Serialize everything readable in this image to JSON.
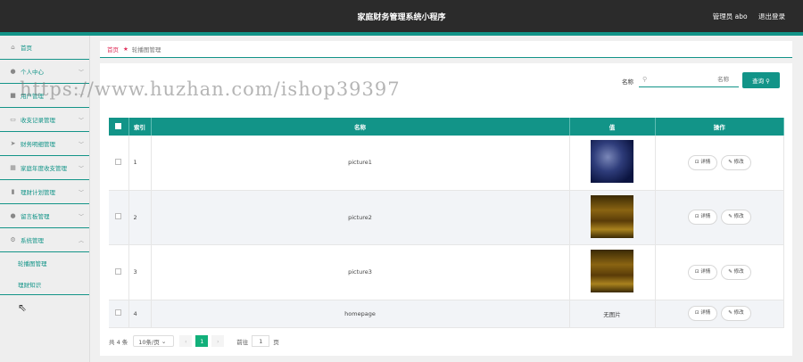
{
  "header": {
    "title": "家庭财务管理系统小程序",
    "user": "管理员 abo",
    "logout": "退出登录"
  },
  "sidebar": {
    "items": [
      {
        "label": "首页",
        "icon": "home-icon",
        "glyph": "⌂",
        "chevron": false
      },
      {
        "label": "个人中心",
        "icon": "user-icon",
        "glyph": "●",
        "chevron": true
      },
      {
        "label": "用户管理",
        "icon": "document-icon",
        "glyph": "■",
        "chevron": true
      },
      {
        "label": "收支记录管理",
        "icon": "message-icon",
        "glyph": "▭",
        "chevron": true
      },
      {
        "label": "财务明细管理",
        "icon": "send-icon",
        "glyph": "➤",
        "chevron": true
      },
      {
        "label": "家庭年度收支管理",
        "icon": "grid-icon",
        "glyph": "▦",
        "chevron": true
      },
      {
        "label": "理财计划管理",
        "icon": "bar-chart-icon",
        "glyph": "▮",
        "chevron": true
      },
      {
        "label": "留言板管理",
        "icon": "location-icon",
        "glyph": "●",
        "chevron": true
      },
      {
        "label": "系统管理",
        "icon": "settings-icon",
        "glyph": "⚙",
        "chevron": true,
        "expanded": true
      }
    ],
    "subitems": [
      {
        "label": "轮播图管理"
      },
      {
        "label": "理财知识"
      }
    ]
  },
  "breadcrumb": {
    "home": "首页",
    "current": "轮播图管理"
  },
  "search": {
    "label": "名称",
    "placeholder": "名称",
    "button": "查询"
  },
  "table": {
    "headers": [
      "索引",
      "名称",
      "值",
      "操作"
    ],
    "rows": [
      {
        "index": "1",
        "name": "picture1",
        "value": "",
        "thumb": "thumb1"
      },
      {
        "index": "2",
        "name": "picture2",
        "value": "",
        "thumb": "thumb2"
      },
      {
        "index": "3",
        "name": "picture3",
        "value": "",
        "thumb": "thumb3"
      },
      {
        "index": "4",
        "name": "homepage",
        "value": "无图片",
        "thumb": ""
      }
    ],
    "detail_label": "详情",
    "edit_label": "修改"
  },
  "pager": {
    "total": "共 4 条",
    "page_size": "10条/页",
    "current_page": "1",
    "goto_label": "前往",
    "goto_value": "1",
    "goto_suffix": "页"
  },
  "watermark": "https://www.huzhan.com/ishop39397",
  "colors": {
    "accent": "#129488",
    "topbar": "#2b2b2b",
    "breadcrumb_home": "#e0305b"
  }
}
